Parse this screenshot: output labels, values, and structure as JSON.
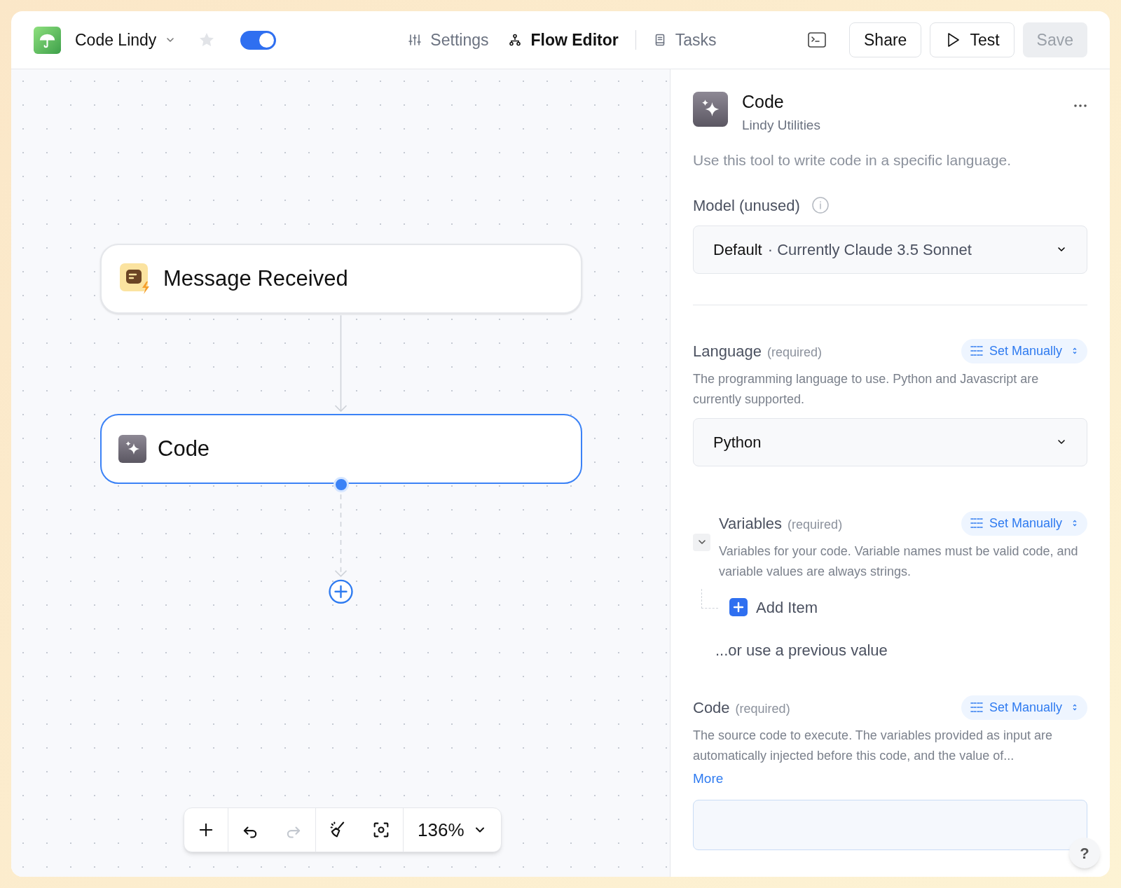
{
  "header": {
    "app_name": "Code Lindy",
    "starred": false,
    "enabled": true,
    "tabs": [
      {
        "label": "Settings",
        "kind": "sliders",
        "selected": false
      },
      {
        "label": "Flow Editor",
        "kind": "flow",
        "selected": true
      },
      {
        "label": "Tasks",
        "kind": "book",
        "selected": false
      }
    ],
    "buttons": [
      {
        "label": "Share",
        "kind": "plain",
        "disabled": false
      },
      {
        "label": "Test",
        "kind": "play",
        "disabled": false
      },
      {
        "label": "Save",
        "kind": "plain",
        "disabled": true
      }
    ]
  },
  "canvas": {
    "nodes": [
      {
        "title": "Message Received",
        "kind": "trigger",
        "selected": false
      },
      {
        "title": "Code",
        "kind": "action",
        "selected": true
      }
    ],
    "tools": [
      {
        "kind": "add",
        "disabled": false
      },
      {
        "kind": "undo",
        "disabled": false
      },
      {
        "kind": "redo",
        "disabled": true
      },
      {
        "kind": "tidy",
        "disabled": false
      },
      {
        "kind": "focus",
        "disabled": false
      }
    ],
    "zoom": "136%"
  },
  "panel": {
    "title": "Code",
    "subtitle": "Lindy Utilities",
    "description": "Use this tool to write code in a specific language.",
    "model": {
      "label": "Model (unused)",
      "value_main": "Default",
      "value_detail": "· Currently Claude 3.5 Sonnet"
    },
    "fields": [
      {
        "kind": "select",
        "label": "Language",
        "required": "(required)",
        "mode": "Set Manually",
        "description": "The programming language to use. Python and Javascript are currently supported.",
        "value": "Python"
      },
      {
        "kind": "list",
        "label": "Variables",
        "required": "(required)",
        "mode": "Set Manually",
        "description": "Variables for your code. Variable names must be valid code, and variable values are always strings.",
        "expanded": true,
        "add_label": "Add Item",
        "alternative": "...or use a previous value"
      },
      {
        "kind": "textarea",
        "label": "Code",
        "required": "(required)",
        "mode": "Set Manually",
        "description": "The source code to execute. The variables provided as input are automatically injected before this code, and the value of...",
        "more": "More"
      }
    ],
    "help": "?"
  }
}
